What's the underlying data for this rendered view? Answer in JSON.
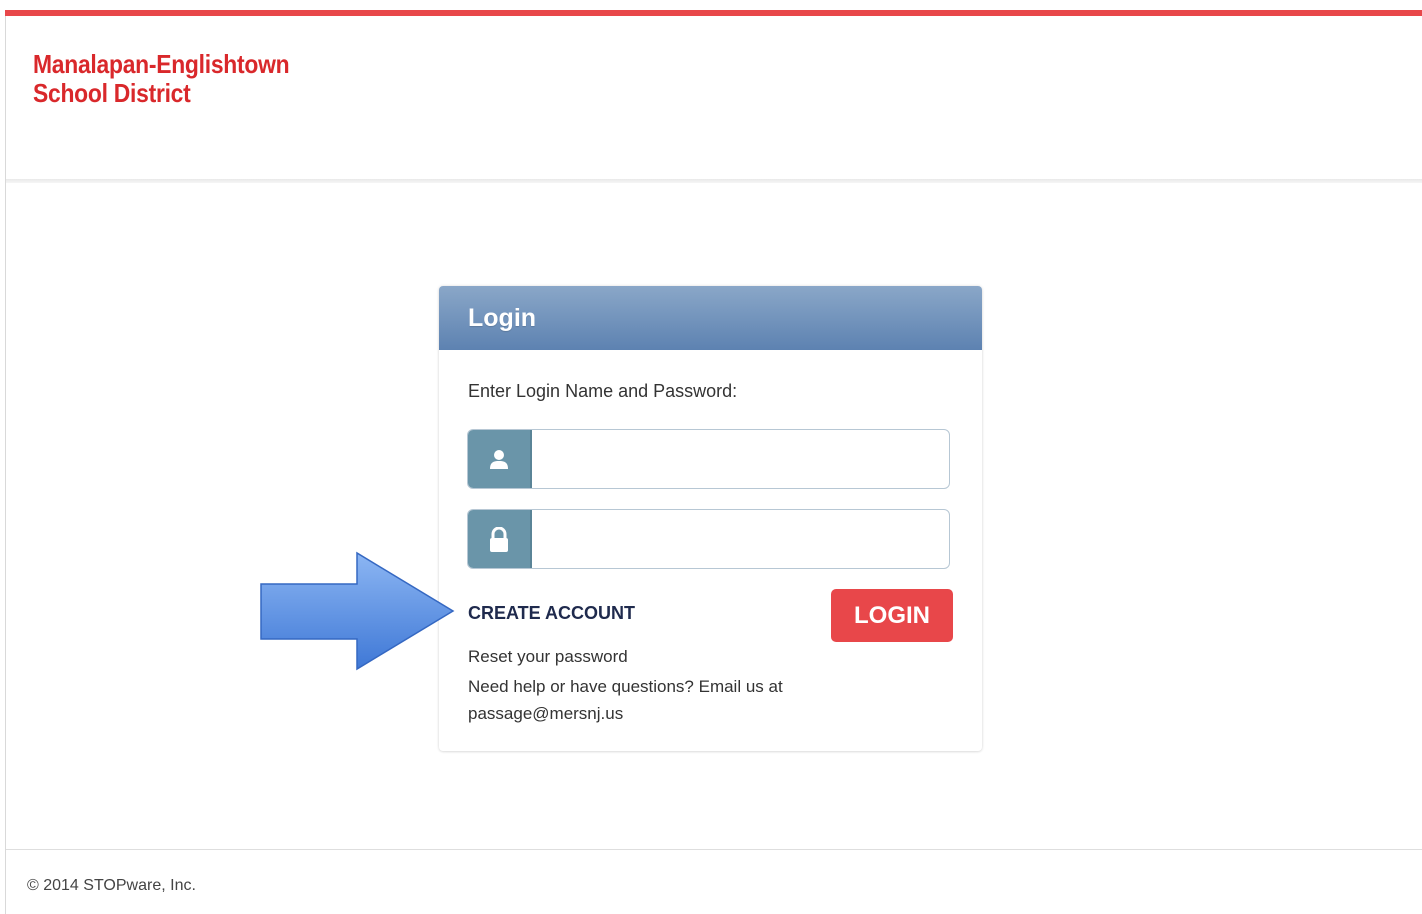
{
  "header": {
    "logo_line1": "Manalapan-Englishtown",
    "logo_line2": "School District",
    "accent_color": "#e8474a"
  },
  "login": {
    "title": "Login",
    "instructions": "Enter Login Name and Password:",
    "username_icon": "user-icon",
    "username_value": "",
    "password_icon": "lock-icon",
    "password_value": "",
    "create_account_label": "CREATE ACCOUNT",
    "login_button_label": "LOGIN",
    "reset_password_label": "Reset your password",
    "help_text": "Need help or have questions? Email us at passage@mersnj.us",
    "header_color": "#6d8fbb"
  },
  "annotation": {
    "arrow_icon": "right-arrow-icon",
    "arrow_color": "#5b8fe0"
  },
  "footer": {
    "copyright": "© 2014 STOPware, Inc."
  }
}
